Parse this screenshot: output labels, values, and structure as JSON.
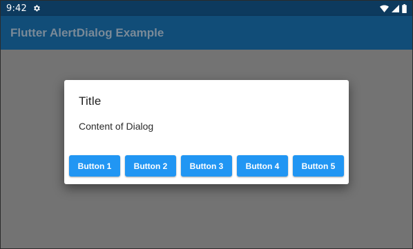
{
  "status_bar": {
    "time": "9:42",
    "icons": [
      "gear-icon",
      "wifi-icon",
      "signal-icon",
      "battery-icon"
    ]
  },
  "app_bar": {
    "title": "Flutter AlertDialog Example"
  },
  "dialog": {
    "title": "Title",
    "content": "Content of Dialog",
    "buttons": [
      {
        "label": "Button 1"
      },
      {
        "label": "Button 2"
      },
      {
        "label": "Button 3"
      },
      {
        "label": "Button 4"
      },
      {
        "label": "Button 5"
      }
    ]
  },
  "colors": {
    "status_bar_bg": "#0d3a5e",
    "app_bar_bg": "#114d78",
    "app_bar_title": "#7a8a98",
    "scrim": "#737373",
    "dialog_bg": "#ffffff",
    "button_bg": "#2196f3",
    "button_text": "#ffffff"
  }
}
